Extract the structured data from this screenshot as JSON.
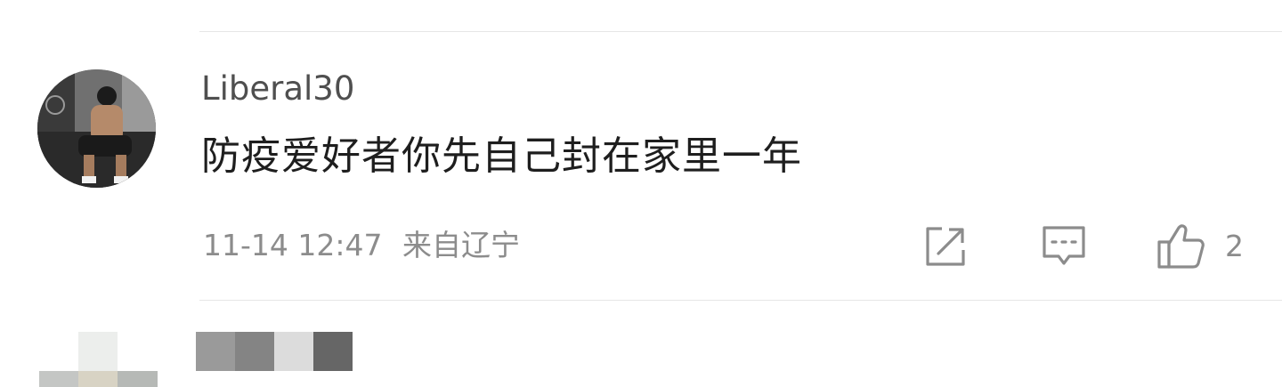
{
  "comment": {
    "username": "Liberal30",
    "text": "防疫爱好者你先自己封在家里一年",
    "time": "11-14 12:47",
    "location": "来自辽宁",
    "avatar_icon": "user-avatar-photo",
    "actions": {
      "share_icon": "share-icon",
      "reply_icon": "comment-reply-icon",
      "like_icon": "thumbs-up-icon",
      "like_count": "2"
    }
  },
  "next_comment": {
    "avatar_icon": "pixelated-avatar",
    "username_icon": "pixelated-username",
    "avatar_colors": [
      "#eceeec",
      "#c4c6c4",
      "#d8d3c4",
      "#b6b9b6"
    ],
    "username_colors": [
      "#9a9a9a",
      "#848484",
      "#dcdcdc",
      "#666666"
    ]
  },
  "colors": {
    "divider": "#e6e6e6",
    "username": "#4f4f4f",
    "text": "#1e1e1e",
    "meta": "#8c8c8c",
    "icon": "#8c8c8c"
  }
}
